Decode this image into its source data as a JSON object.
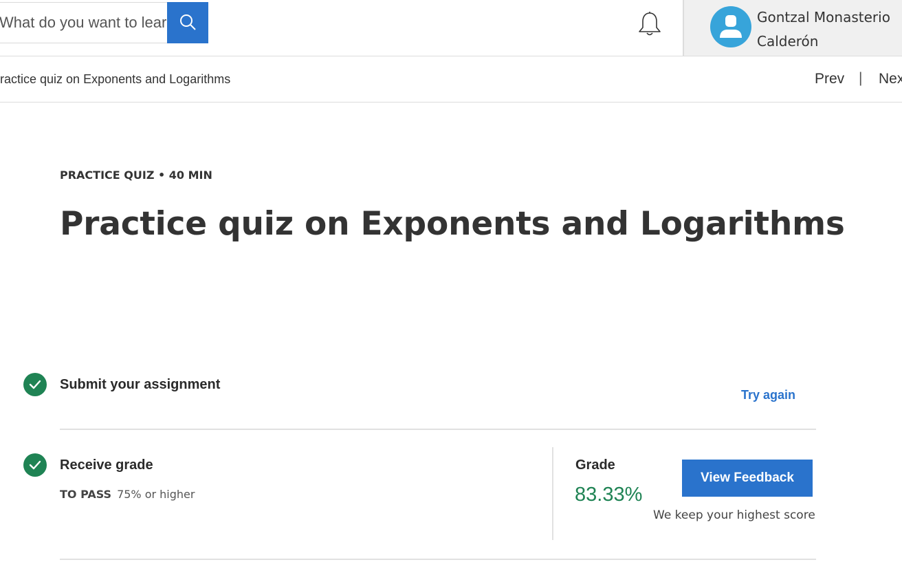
{
  "header": {
    "search": {
      "placeholder": "What do you want to learn?"
    },
    "user": {
      "name": "Gontzal Monasterio Calderón"
    },
    "icons": {
      "search": "search-icon",
      "notifications": "bell-icon",
      "avatar": "user-avatar-icon"
    },
    "colors": {
      "accent": "#2a73cc",
      "avatar_bg": "#37a4da"
    }
  },
  "nav": {
    "breadcrumb": "Practice quiz on Exponents and Logarithms",
    "prev_label": "Prev",
    "separator": "|",
    "next_label": "Next"
  },
  "quiz": {
    "meta": "PRACTICE QUIZ • 40 MIN",
    "title": "Practice quiz on Exponents and Logarithms"
  },
  "steps": {
    "submit": {
      "title": "Submit your assignment",
      "action_label": "Try again",
      "status": "completed"
    },
    "grade": {
      "title": "Receive grade",
      "to_pass_label": "TO PASS",
      "to_pass_value": "75% or higher",
      "grade_label": "Grade",
      "grade_value": "83.33%",
      "feedback_button": "View Feedback",
      "note": "We keep your highest score",
      "status": "completed"
    },
    "colors": {
      "success": "#1f8354"
    }
  }
}
